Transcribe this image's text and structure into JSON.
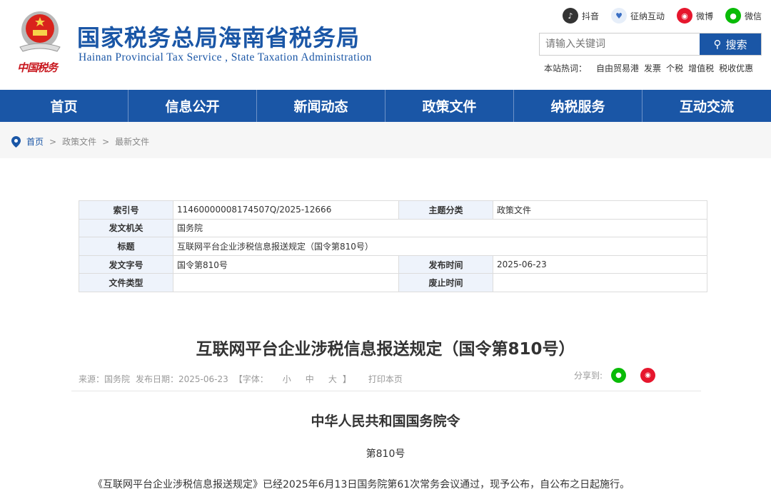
{
  "header": {
    "logo_text": "中国税务",
    "site_name_cn": "国家税务总局海南省税务局",
    "site_name_en": "Hainan  Provincial  Tax Service , State Taxation  Administration"
  },
  "social": [
    {
      "label": "抖音",
      "icon": "douyin-icon",
      "color": "#333333"
    },
    {
      "label": "征纳互动",
      "icon": "heart-icon",
      "color": "#3a6fc4"
    },
    {
      "label": "微博",
      "icon": "weibo-icon",
      "color": "#e6162d"
    },
    {
      "label": "微信",
      "icon": "wechat-icon",
      "color": "#09bb07"
    }
  ],
  "search": {
    "placeholder": "请输入关键词",
    "button": "搜索"
  },
  "hot": {
    "label": "本站热词：",
    "items": [
      "自由贸易港",
      "发票",
      "个税",
      "增值税",
      "税收优惠"
    ]
  },
  "nav": [
    "首页",
    "信息公开",
    "新闻动态",
    "政策文件",
    "纳税服务",
    "互动交流"
  ],
  "breadcrumb": [
    "首页",
    "政策文件",
    "最新文件"
  ],
  "info": {
    "index_label": "索引号",
    "index": "11460000008174507Q/2025-12666",
    "topic_label": "主题分类",
    "topic": "政策文件",
    "issuer_label": "发文机关",
    "issuer": "国务院",
    "title_label": "标题",
    "title": "互联网平台企业涉税信息报送规定（国令第810号）",
    "docno_label": "发文字号",
    "docno": "国令第810号",
    "pubdate_label": "发布时间",
    "pubdate": "2025-06-23",
    "type_label": "文件类型",
    "type": "",
    "abolish_label": "废止时间",
    "abolish": ""
  },
  "article": {
    "title": "互联网平台企业涉税信息报送规定（国令第810号）",
    "source": "来源：国务院",
    "date": "发布日期：2025-06-23",
    "font_open": "【字体：",
    "font_small": "小",
    "font_medium": "中",
    "font_large": "大",
    "font_close": "】",
    "print": "打印本页",
    "share": "分享到:",
    "heading": "中华人民共和国国务院令",
    "number": "第810号",
    "para": "《互联网平台企业涉税信息报送规定》已经2025年6月13日国务院第61次常务会议通过，现予公布，自公布之日起施行。"
  }
}
